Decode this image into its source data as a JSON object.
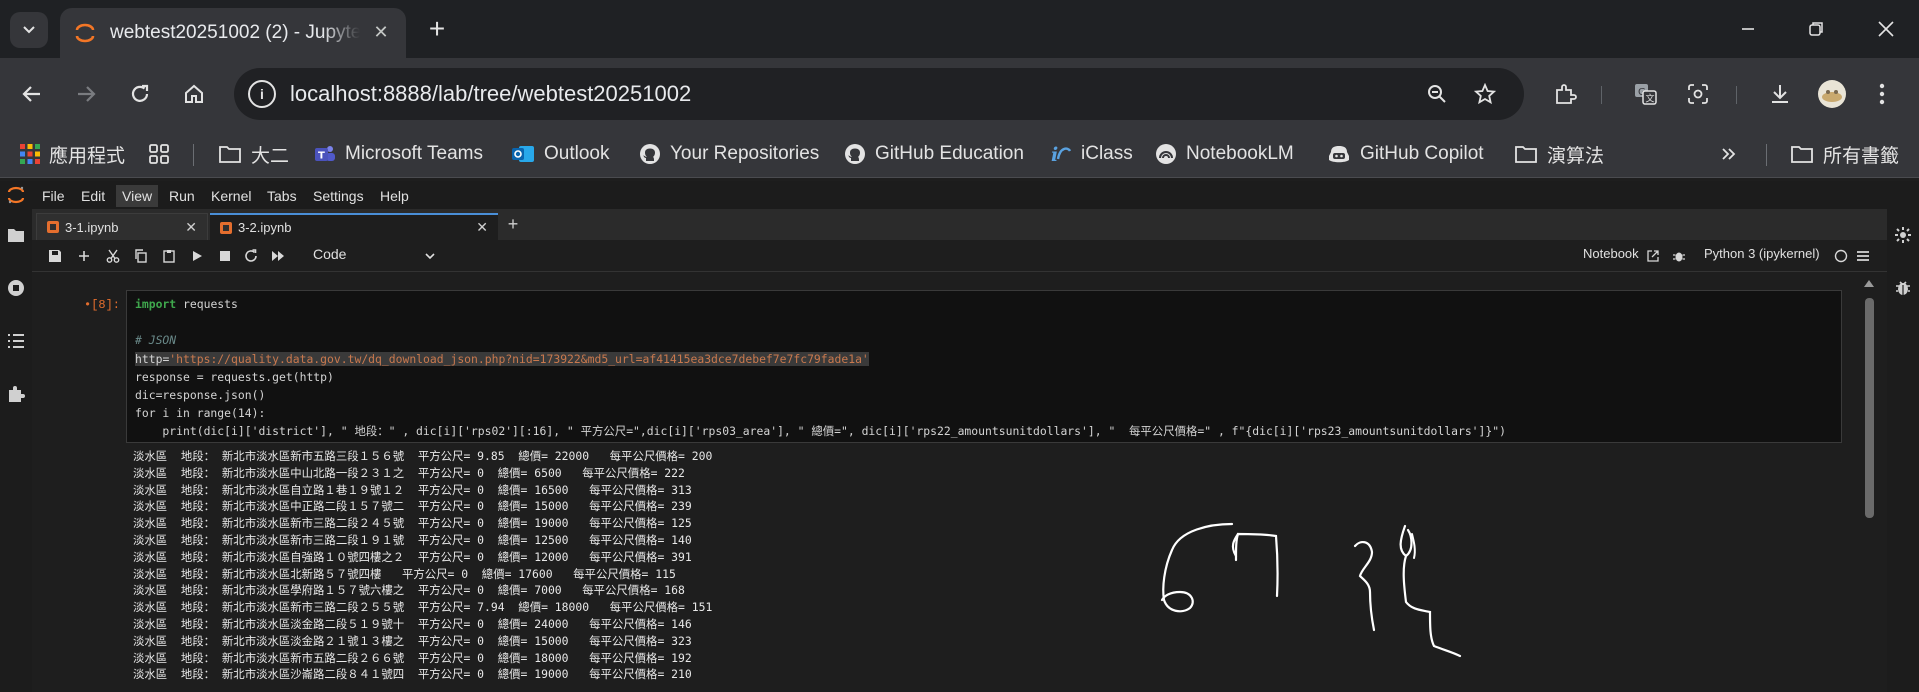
{
  "browser": {
    "tab_title": "webtest20251002 (2) - Jupyte",
    "url": "localhost:8888/lab/tree/webtest20251002",
    "bookmarks": [
      {
        "label": "應用程式",
        "icon": "apps-grid-icon"
      },
      {
        "label": "",
        "icon": "tab-groups-icon"
      },
      {
        "label": "大二",
        "icon": "folder-icon"
      },
      {
        "label": "Microsoft Teams",
        "icon": "teams-icon"
      },
      {
        "label": "Outlook",
        "icon": "outlook-icon"
      },
      {
        "label": "Your Repositories",
        "icon": "github-icon"
      },
      {
        "label": "GitHub Education",
        "icon": "github-icon"
      },
      {
        "label": "iClass",
        "icon": "iclass-icon"
      },
      {
        "label": "NotebookLM",
        "icon": "notebooklm-icon"
      },
      {
        "label": "GitHub Copilot",
        "icon": "copilot-icon"
      },
      {
        "label": "演算法",
        "icon": "folder-icon"
      }
    ],
    "all_bookmarks": "所有書籤"
  },
  "jupyter": {
    "menu": [
      "File",
      "Edit",
      "View",
      "Run",
      "Kernel",
      "Tabs",
      "Settings",
      "Help"
    ],
    "active_menu": "View",
    "tabs": [
      {
        "label": "3-1.ipynb",
        "active": false
      },
      {
        "label": "3-2.ipynb",
        "active": true
      }
    ],
    "cell_type": "Code",
    "notebook_label": "Notebook",
    "kernel": "Python 3 (ipykernel)",
    "prompt": "•[8]:"
  },
  "code": {
    "line1_kw": "import",
    "line1_rest": " requests",
    "comment": "# JSON",
    "http_var": "http",
    "http_str": "'https://quality.data.gov.tw/dq_download_json.php?nid=173922&md5_url=af41415ea3dce7debef7e7fc79fade1a'",
    "line_response": "response = requests.get(http)",
    "line_dic": "dic=response.json()",
    "line_for": "for i in range(14):",
    "line_print": "    print(dic[i]['district'], \" 地段：\" , dic[i]['rps02'][:16], \" 平方公尺=\",dic[i]['rps03_area'], \" 總價=\", dic[i]['rps22_amountsunitdollars'], \"  每平公尺價格=\" , f\"{dic[i]['rps23_amountsunitdollars']}\")"
  },
  "output_lines": [
    "淡水區  地段： 新北市淡水區新市五路三段１５６號  平方公尺= 9.85  總價= 22000   每平公尺價格= 200",
    "淡水區  地段： 新北市淡水區中山北路一段２３１之  平方公尺= 0  總價= 6500   每平公尺價格= 222",
    "淡水區  地段： 新北市淡水區自立路１巷１９號１２  平方公尺= 0  總價= 16500   每平公尺價格= 313",
    "淡水區  地段： 新北市淡水區中正路二段１５７號二  平方公尺= 0  總價= 15000   每平公尺價格= 239",
    "淡水區  地段： 新北市淡水區新市三路二段２４５號  平方公尺= 0  總價= 19000   每平公尺價格= 125",
    "淡水區  地段： 新北市淡水區新市三路二段１９１號  平方公尺= 0  總價= 12500   每平公尺價格= 140",
    "淡水區  地段： 新北市淡水區自強路１０號四樓之２  平方公尺= 0  總價= 12000   每平公尺價格= 391",
    "淡水區  地段： 新北市淡水區北新路５７號四樓   平方公尺= 0  總價= 17600   每平公尺價格= 115",
    "淡水區  地段： 新北市淡水區學府路１５７號六樓之  平方公尺= 0  總價= 7000   每平公尺價格= 168",
    "淡水區  地段： 新北市淡水區新市三路二段２５５號  平方公尺= 7.94  總價= 18000   每平公尺價格= 151",
    "淡水區  地段： 新北市淡水區淡金路二段５１９號十  平方公尺= 0  總價= 24000   每平公尺價格= 146",
    "淡水區  地段： 新北市淡水區淡金路２１號１３樓之  平方公尺= 0  總價= 15000   每平公尺價格= 323",
    "淡水區  地段： 新北市淡水區新市五路二段２６６號  平方公尺= 0  總價= 18000   每平公尺價格= 192",
    "淡水區  地段： 新北市淡水區沙崙路二段８４１號四  平方公尺= 0  總價= 19000   每平公尺價格= 210"
  ],
  "colors": {
    "accent_orange": "#e46e2e",
    "tab_active_blue": "#4a8fd8",
    "keyword_green": "#3fa84d",
    "string_orange": "#c9794e"
  }
}
